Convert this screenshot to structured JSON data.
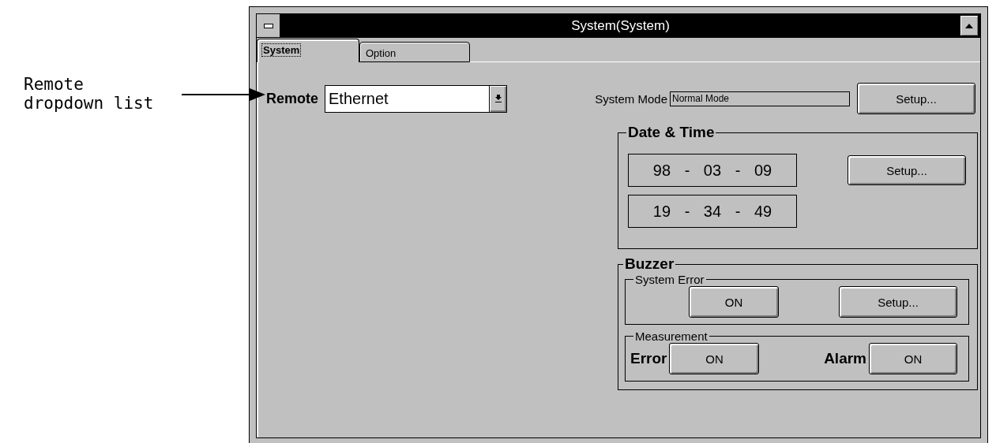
{
  "annotation": {
    "text": "Remote dropdown list"
  },
  "window": {
    "title": "System(System)"
  },
  "tabs": [
    {
      "label": "System",
      "selected": true
    },
    {
      "label": "Option",
      "selected": false
    }
  ],
  "remote": {
    "label": "Remote",
    "value": "Ethernet"
  },
  "system_mode": {
    "label": "System Mode",
    "value": "Normal Mode",
    "button": "Setup..."
  },
  "date_time": {
    "title": "Date & Time",
    "date": "98 - 03 - 09",
    "time": "19 - 34 - 49",
    "button": "Setup..."
  },
  "buzzer": {
    "title": "Buzzer",
    "system_error": {
      "title": "System Error",
      "toggle": "ON",
      "button": "Setup..."
    },
    "measurement": {
      "title": "Measurement",
      "items": [
        {
          "label": "Error",
          "value": "ON"
        },
        {
          "label": "Alarm",
          "value": "ON"
        }
      ]
    }
  }
}
